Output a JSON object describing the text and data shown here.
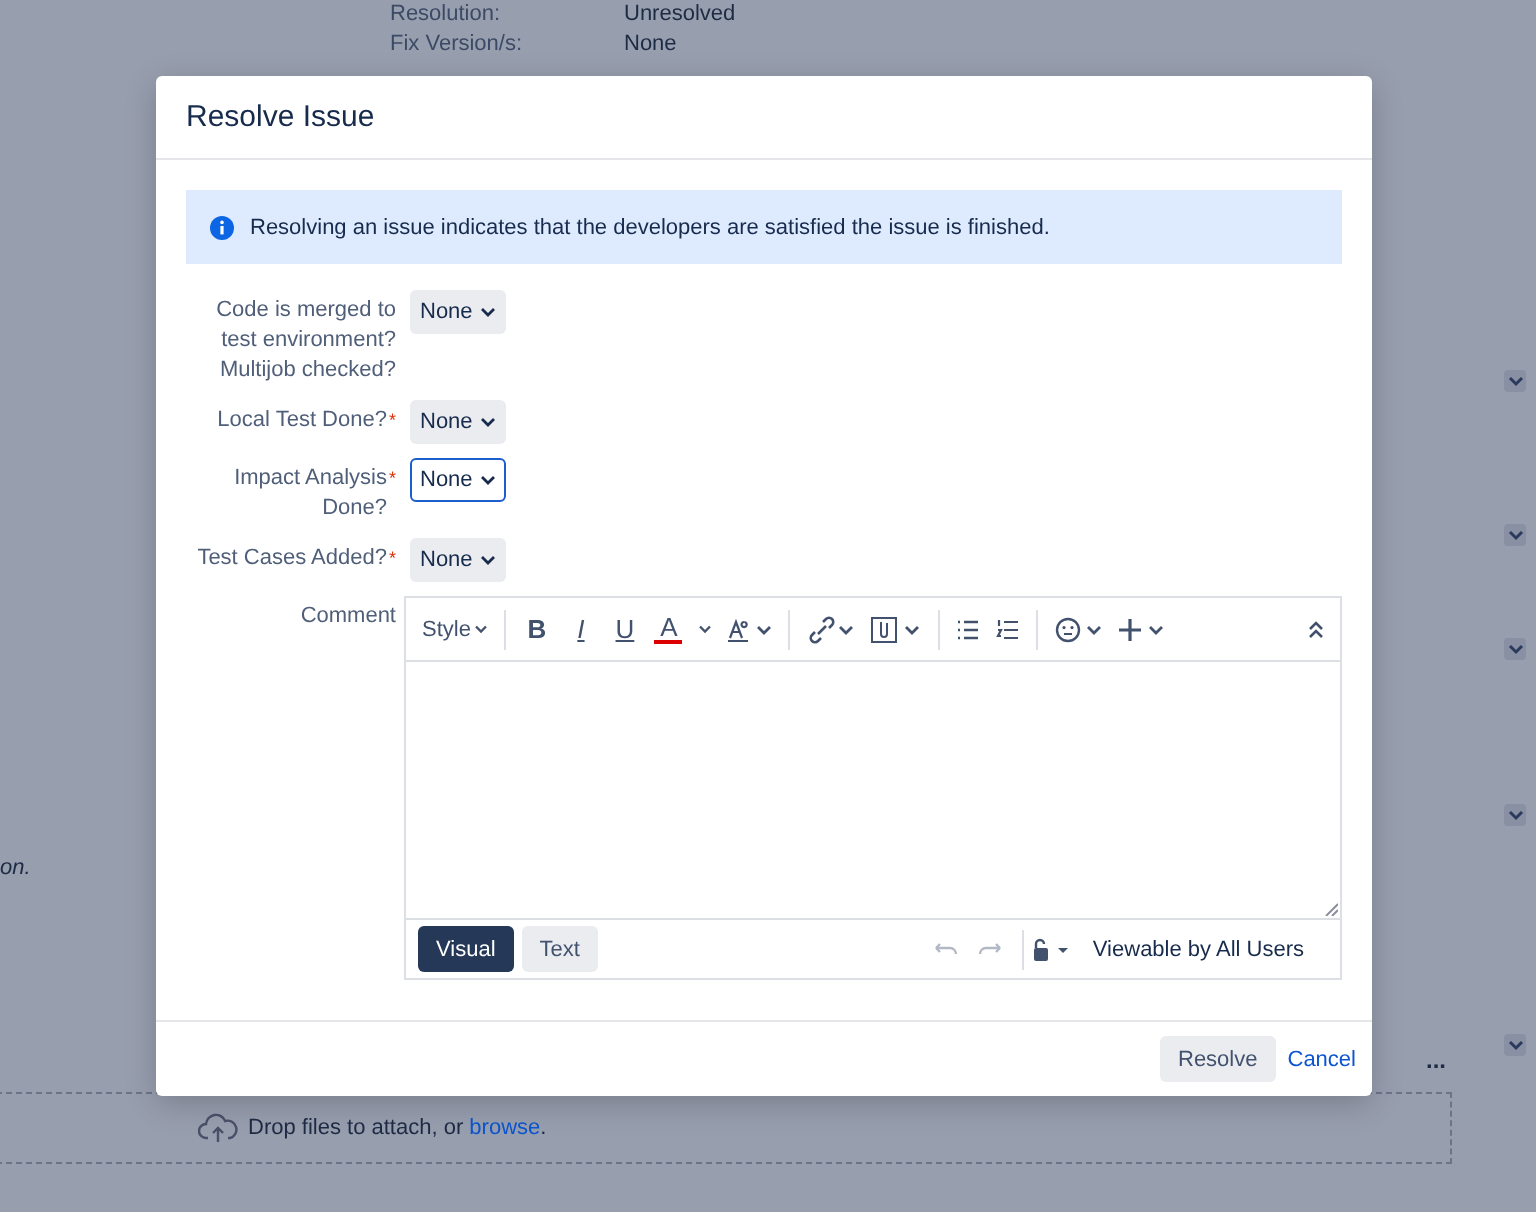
{
  "background": {
    "fields": [
      {
        "label": "Resolution:",
        "value": "Unresolved"
      },
      {
        "label": "Fix Version/s:",
        "value": "None"
      }
    ],
    "side_text": "on.",
    "more_menu": "...",
    "dropzone": {
      "text": "Drop files to attach, or ",
      "link": "browse",
      "after": "."
    }
  },
  "dialog": {
    "title": "Resolve Issue",
    "info": "Resolving an issue indicates that the developers are satisfied the issue is finished.",
    "required_mark": "*",
    "fields": [
      {
        "label": "Code is merged to test environment? Multijob checked?",
        "required": false,
        "value": "None",
        "focused": false
      },
      {
        "label": "Local Test Done?",
        "required": true,
        "value": "None",
        "focused": false
      },
      {
        "label": "Impact Analysis Done?",
        "required": true,
        "value": "None",
        "focused": true
      },
      {
        "label": "Test Cases Added?",
        "required": true,
        "value": "None",
        "focused": false
      }
    ],
    "comment": {
      "label": "Comment",
      "style_menu": "Style",
      "format_buttons": [
        "B",
        "I",
        "U",
        "A"
      ],
      "modes": [
        {
          "label": "Visual",
          "selected": true
        },
        {
          "label": "Text",
          "selected": false
        }
      ],
      "visibility": "Viewable by All Users"
    },
    "resolve_button": "Resolve",
    "cancel_link": "Cancel"
  }
}
